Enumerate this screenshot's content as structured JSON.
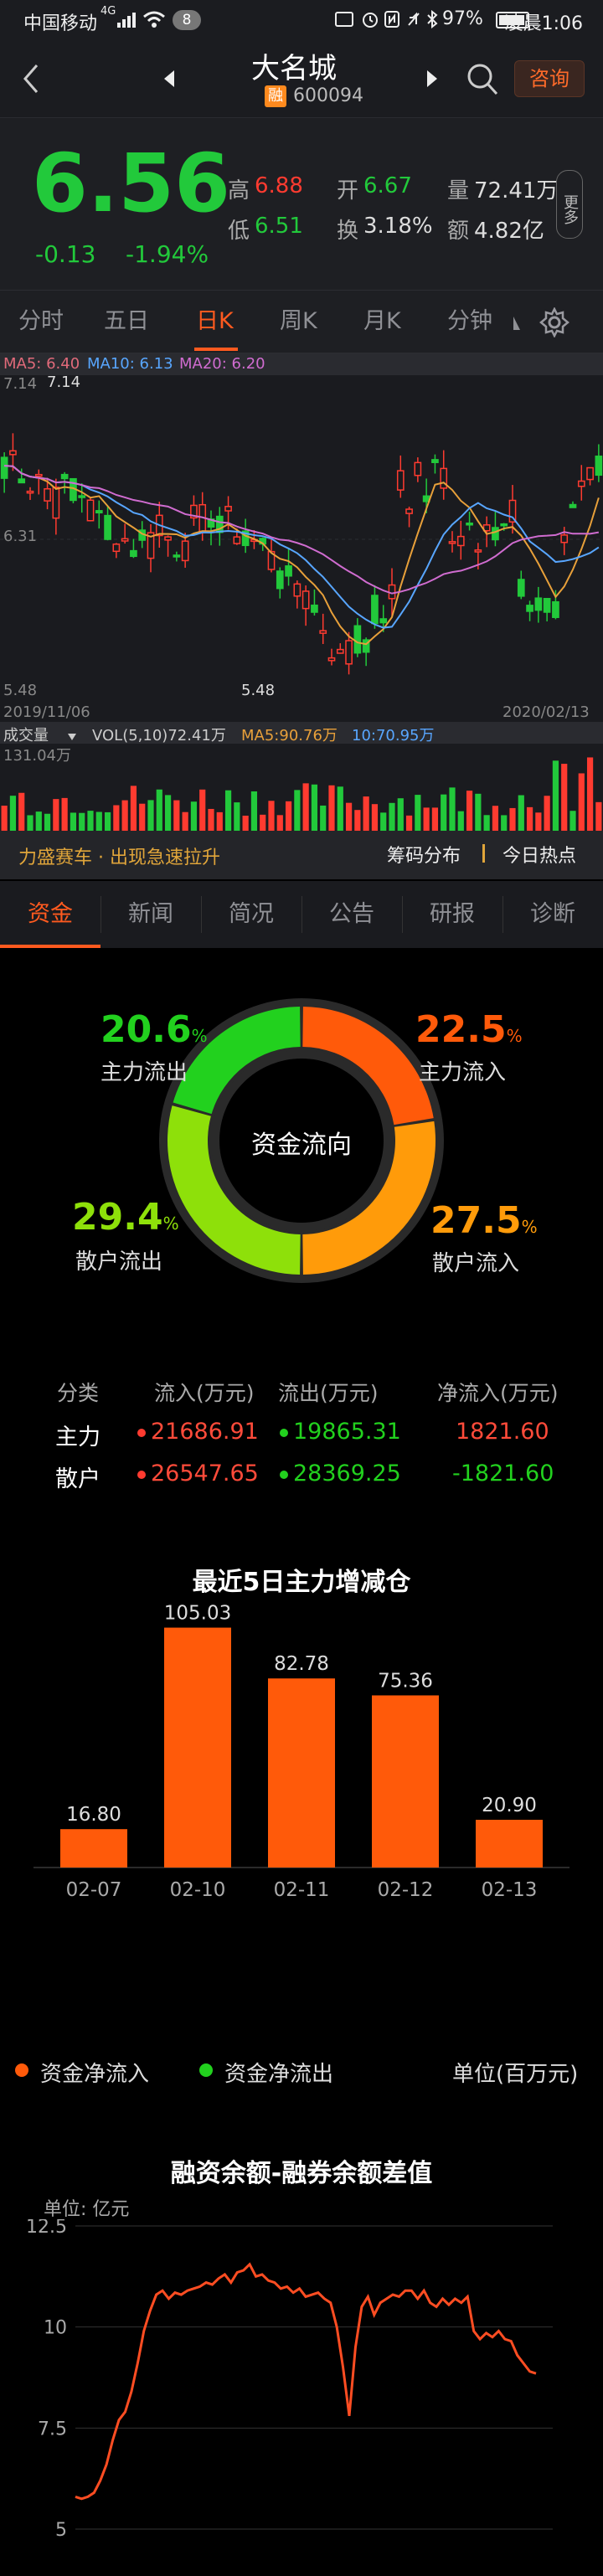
{
  "status_bar": {
    "carrier": "中国移动",
    "network": "4G",
    "notif_count": "8",
    "battery": "97%",
    "time": "凌晨1:06"
  },
  "header": {
    "stock_name": "大名城",
    "rong_badge": "融",
    "stock_code": "600094",
    "consult_label": "咨询"
  },
  "quote": {
    "price": "6.56",
    "change": "-0.13",
    "change_pct": "-1.94%",
    "high_label": "高",
    "high": "6.88",
    "low_label": "低",
    "low": "6.51",
    "open_label": "开",
    "open": "6.67",
    "turnover_label": "换",
    "turnover": "3.18%",
    "volume_label": "量",
    "volume": "72.41万",
    "amount_label": "额",
    "amount": "4.82亿",
    "more_label": "更多"
  },
  "kline_tabs": [
    "分时",
    "五日",
    "日K",
    "周K",
    "月K",
    "分钟"
  ],
  "kline_active": "日K",
  "kchart": {
    "ma5": "MA5: 6.40",
    "ma10": "MA10: 6.13",
    "ma20": "MA20: 6.20",
    "top_left_price": "7.14",
    "top_price_tag": "7.14",
    "mid_price": "6.31",
    "low_price": "5.48",
    "min_tag": "5.48",
    "date_start": "2019/11/06",
    "date_end": "2020/02/13",
    "vol_selector": "成交量",
    "vol_info": "VOL(5,10)72.41万",
    "vol_ma5": "MA5:90.76万",
    "vol_ma10": "10:70.95万",
    "vol_max": "131.04万"
  },
  "banner": {
    "promo": "力盛赛车 · 出现急速拉升",
    "chip_label": "筹码分布",
    "hot_label": "今日热点"
  },
  "section_tabs": [
    "资金",
    "新闻",
    "简况",
    "公告",
    "研报",
    "诊断"
  ],
  "section_active": "资金",
  "capital_flow": {
    "title": "资金流向",
    "main_out_pct": "20.6",
    "main_out_label": "主力流出",
    "main_in_pct": "22.5",
    "main_in_label": "主力流入",
    "retail_out_pct": "29.4",
    "retail_out_label": "散户流出",
    "retail_in_pct": "27.5",
    "retail_in_label": "散户流入",
    "pct_sign": "%",
    "table_headers": [
      "分类",
      "流入(万元)",
      "流出(万元)",
      "净流入(万元)"
    ],
    "rows": [
      {
        "category": "主力",
        "inflow": "21686.91",
        "outflow": "19865.31",
        "net": "1821.60"
      },
      {
        "category": "散户",
        "inflow": "26547.65",
        "outflow": "28369.25",
        "net": "-1821.60"
      }
    ]
  },
  "chart_data": [
    {
      "type": "pie",
      "title": "资金流向",
      "labels": [
        "主力流入",
        "散户流入",
        "散户流出",
        "主力流出"
      ],
      "values": [
        22.5,
        27.5,
        29.4,
        20.6
      ],
      "colors": [
        "#ff5a0a",
        "#ff9b0a",
        "#8ee00a",
        "#22d11e"
      ]
    },
    {
      "type": "bar",
      "title": "最近5日主力增减仓",
      "categories": [
        "02-07",
        "02-10",
        "02-11",
        "02-12",
        "02-13"
      ],
      "values": [
        16.8,
        105.03,
        82.78,
        75.36,
        20.9
      ],
      "value_labels": [
        "16.80",
        "105.03",
        "82.78",
        "75.36",
        "20.90"
      ],
      "legend": [
        "资金净流入",
        "资金净流出"
      ],
      "legend_colors": [
        "#ff5a0a",
        "#22d11e"
      ],
      "unit": "单位(百万元)",
      "bar_color": "#ff5a0a"
    },
    {
      "type": "line",
      "title": "融资余额-融券余额差值",
      "unit": "单位: 亿元",
      "y_ticks": [
        "12.5",
        "10",
        "7.5",
        "5"
      ],
      "ylim": [
        5,
        12.5
      ],
      "values": [
        5.8,
        5.75,
        5.8,
        5.9,
        6.2,
        6.6,
        7.2,
        7.7,
        7.9,
        8.4,
        9.1,
        9.9,
        10.4,
        10.8,
        10.9,
        10.7,
        10.85,
        10.8,
        10.9,
        10.95,
        11.0,
        11.1,
        11.05,
        11.2,
        11.3,
        11.1,
        11.35,
        11.4,
        11.55,
        11.25,
        11.3,
        11.15,
        11.1,
        10.95,
        11.0,
        10.85,
        10.95,
        10.75,
        10.8,
        10.85,
        10.7,
        10.6,
        10.0,
        9.0,
        7.8,
        9.5,
        10.5,
        10.75,
        10.3,
        10.6,
        10.7,
        10.8,
        10.75,
        10.9,
        10.9,
        10.7,
        10.9,
        10.6,
        10.5,
        10.7,
        10.55,
        10.7,
        10.6,
        10.75,
        9.9,
        9.7,
        9.85,
        9.75,
        9.9,
        9.7,
        9.65,
        9.3,
        9.1,
        8.9,
        8.85
      ],
      "line_color": "#ff4d22"
    }
  ]
}
